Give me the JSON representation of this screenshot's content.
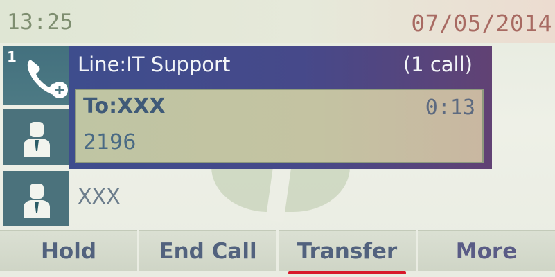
{
  "status_bar": {
    "time": "13:25",
    "date": "07/05/2014"
  },
  "line1": {
    "number": "1",
    "line_label": "Line:IT Support",
    "call_count": "(1 call)"
  },
  "active_call": {
    "to_label": "To:XXX",
    "duration": "0:13",
    "number": "2196"
  },
  "line3": {
    "name": "XXX"
  },
  "softkeys": [
    {
      "label": "Hold"
    },
    {
      "label": "End Call"
    },
    {
      "label": "Transfer",
      "highlighted": true
    },
    {
      "label": "More"
    }
  ],
  "colors": {
    "header_bg": "#46498a",
    "call_card_bg": "#c4c3a2",
    "tile_bg": "#4b727c",
    "highlight_underline": "#d8182a"
  },
  "icons": {
    "line1": "phone-handset-icon",
    "line2": "person-icon",
    "line3": "person-icon"
  }
}
